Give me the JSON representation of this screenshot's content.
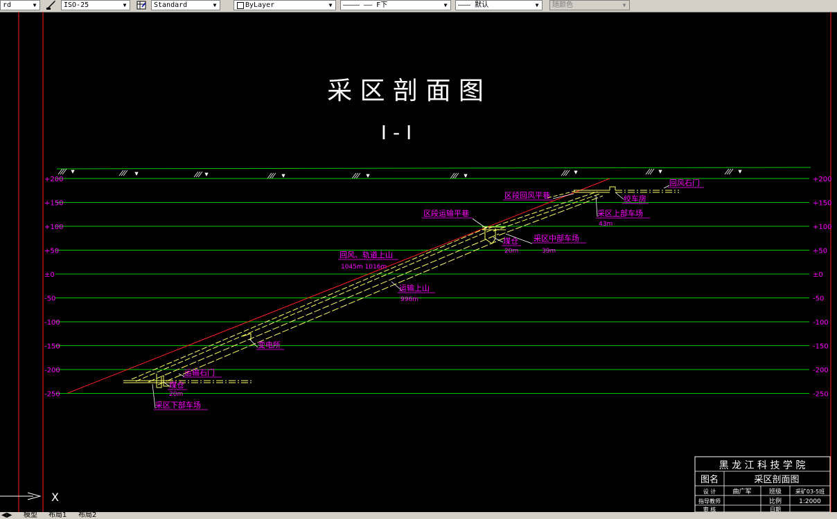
{
  "toolbar": {
    "style_fragment": "rd",
    "dimstyle": "ISO-25",
    "tablestyle": "Standard",
    "layer_color": "ByLayer",
    "linetype": "———— —— F下",
    "lineweight": "——— 默认",
    "plotstyle": "随颜色"
  },
  "drawing": {
    "title": "采 区 剖 面 图",
    "section": "I - I"
  },
  "elevations": {
    "left": [
      "+200",
      "+150",
      "+100",
      "+50",
      "±0",
      "-50",
      "-100",
      "-150",
      "-200",
      "-250"
    ],
    "right": [
      "+200",
      "+150",
      "+100",
      "+50",
      "±0",
      "-50",
      "-100",
      "-150",
      "-200",
      "-250"
    ]
  },
  "labels": {
    "return_stone_gate": "回风石门",
    "winch_room": "绞车房",
    "upper_yard": "采区上部车场",
    "upper_yard_len": "43m",
    "section_return": "区段回风平巷",
    "section_haul": "区段运输平巷",
    "coal_bin_mid": "煤仓",
    "coal_bin_mid_len": "20m",
    "middle_yard": "采区中部车场",
    "middle_yard_len": "39m",
    "return_track_rise": "回风、轨道上山",
    "return_track_len": "1045m  1016m",
    "haul_rise": "运输上山",
    "haul_rise_len": "996m",
    "substation": "变电所",
    "haul_stone_gate": "运输石门",
    "coal_bin_low": "煤仓",
    "coal_bin_low_len": "20m",
    "lower_yard": "采区下部车场"
  },
  "title_block": {
    "school": "黑 龙 江 科 技 学 院",
    "name_label": "图名",
    "name_value": "采区剖面图",
    "drafter_label": "设 计",
    "drafter_value": "曲广军",
    "class_label": "班级",
    "class_value": "采矿03-5班",
    "advisor_label": "指导教师",
    "scale_label": "比例",
    "scale_value": "1:2000",
    "review_label": "审 核",
    "date_label": "日期"
  },
  "tabs": [
    "模型",
    "布局1",
    "布局2"
  ],
  "ucs": {
    "x_label": "X"
  },
  "colors": {
    "background": "#000000",
    "grid_line": "#00c800",
    "label": "#ff00ff",
    "roadway": "#ffff66",
    "coal_seam": "#ff2020",
    "border": "#ff2020",
    "text": "#ffffff"
  }
}
